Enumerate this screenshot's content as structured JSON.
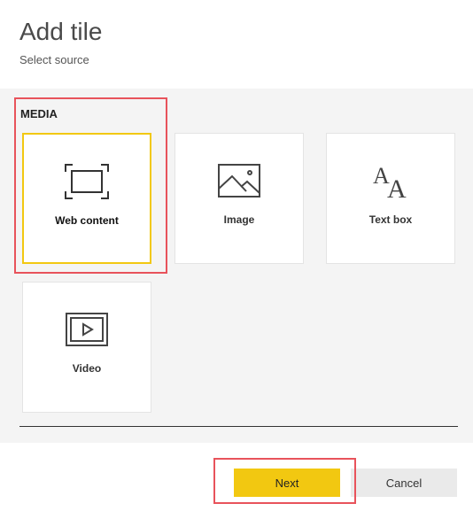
{
  "dialog": {
    "title": "Add tile",
    "subtitle": "Select source"
  },
  "section": {
    "label": "MEDIA"
  },
  "tiles": [
    {
      "label": "Web content",
      "icon": "web-content-icon",
      "selected": true
    },
    {
      "label": "Image",
      "icon": "image-icon",
      "selected": false
    },
    {
      "label": "Text box",
      "icon": "text-box-icon",
      "selected": false
    },
    {
      "label": "Video",
      "icon": "video-icon",
      "selected": false
    }
  ],
  "footer": {
    "next_label": "Next",
    "cancel_label": "Cancel"
  },
  "colors": {
    "accent": "#f2c811",
    "highlight": "#e8535b",
    "panel": "#f4f4f4"
  }
}
